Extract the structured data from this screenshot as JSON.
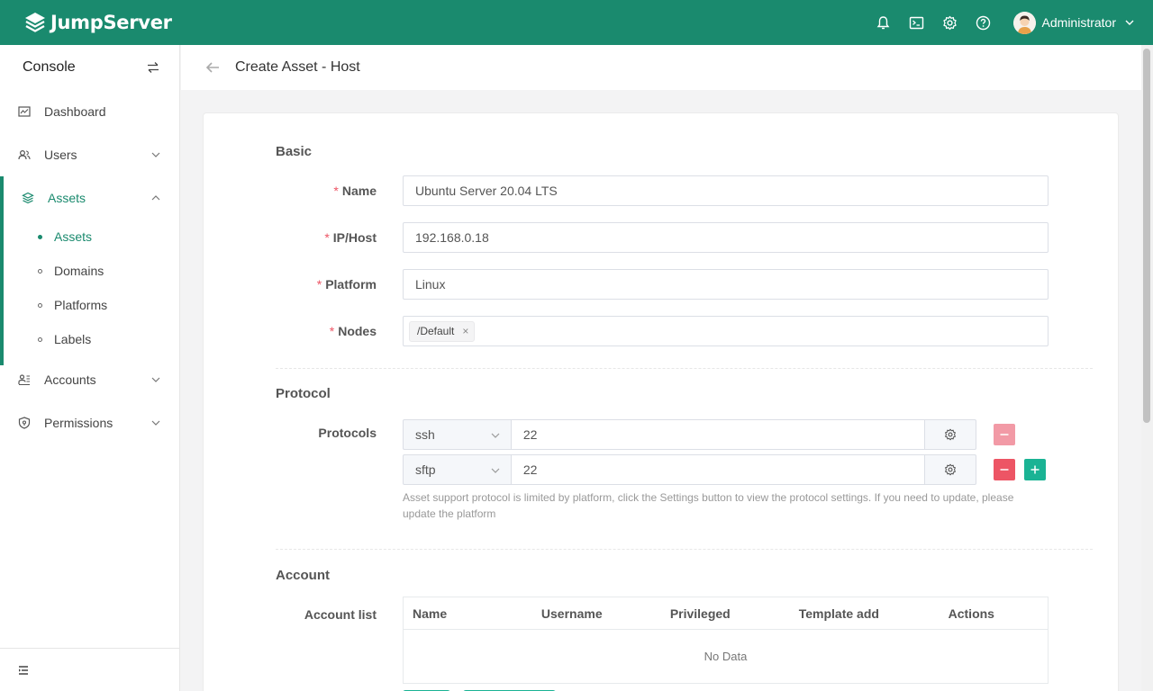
{
  "app": {
    "logo_text": "JumpServer"
  },
  "topbar": {
    "icons": [
      "bell-icon",
      "terminal-icon",
      "gear-icon",
      "help-icon"
    ],
    "user_name": "Administrator"
  },
  "sidebar": {
    "title": "Console",
    "items": [
      {
        "label": "Dashboard",
        "icon": "dashboard-icon"
      },
      {
        "label": "Users",
        "icon": "users-icon"
      },
      {
        "label": "Assets",
        "icon": "layers-icon"
      },
      {
        "label": "Accounts",
        "icon": "accounts-icon"
      },
      {
        "label": "Permissions",
        "icon": "shield-icon"
      }
    ],
    "asset_subitems": [
      {
        "label": "Assets"
      },
      {
        "label": "Domains"
      },
      {
        "label": "Platforms"
      },
      {
        "label": "Labels"
      }
    ]
  },
  "page": {
    "title": "Create Asset - Host"
  },
  "form": {
    "basic": {
      "title": "Basic",
      "name_label": "Name",
      "name_value": "Ubuntu Server 20.04 LTS",
      "ip_label": "IP/Host",
      "ip_value": "192.168.0.18",
      "platform_label": "Platform",
      "platform_value": "Linux",
      "nodes_label": "Nodes",
      "nodes_tag": "/Default",
      "tag_close": "×"
    },
    "protocol": {
      "title": "Protocol",
      "label": "Protocols",
      "rows": [
        {
          "name": "ssh",
          "port": "22"
        },
        {
          "name": "sftp",
          "port": "22"
        }
      ],
      "help": "Asset support protocol is limited by platform, click the Settings button to view the protocol settings. If you need to update, please update the platform"
    },
    "account": {
      "title": "Account",
      "label": "Account list",
      "columns": [
        "Name",
        "Username",
        "Privileged",
        "Template add",
        "Actions"
      ],
      "empty": "No Data"
    }
  },
  "colors": {
    "brand": "#1a8a6e",
    "danger": "#ed5565",
    "success": "#1ab394"
  }
}
